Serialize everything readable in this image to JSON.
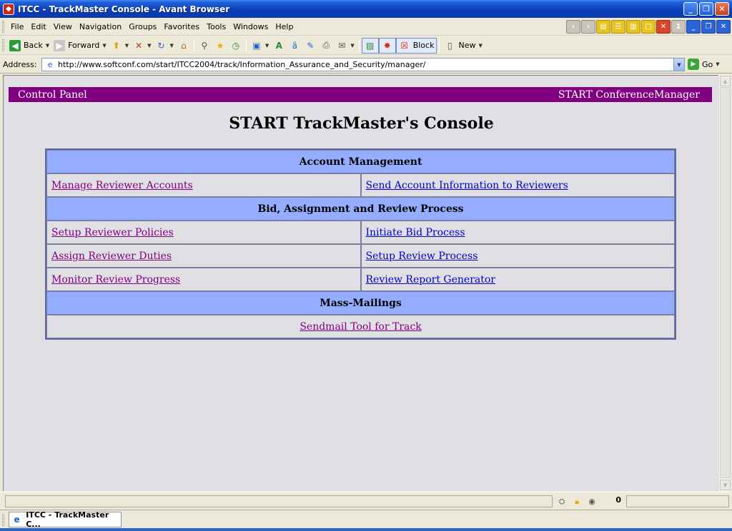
{
  "window": {
    "title": "ITCC - TrackMaster Console - Avant Browser",
    "minimize": "_",
    "maximize": "❐",
    "close": "✕"
  },
  "menu": [
    "File",
    "Edit",
    "View",
    "Navigation",
    "Groups",
    "Favorites",
    "Tools",
    "Windows",
    "Help"
  ],
  "mdi_counter": "1",
  "toolbar": {
    "back_label": "Back",
    "forward_label": "Forward",
    "block_label": "Block",
    "new_label": "New"
  },
  "address": {
    "label": "Address:",
    "url": "http://www.softconf.com/start/ITCC2004/track/Information_Assurance_and_Security/manager/",
    "go_label": "Go"
  },
  "page": {
    "header_left": "Control Panel",
    "header_right": "START ConferenceManager",
    "title": "START TrackMaster's Console",
    "header_color": "#800080",
    "section_color": "#94adff",
    "sections": {
      "account": "Account Management",
      "bid": "Bid, Assignment and Review Process",
      "mail": "Mass-Mailings"
    },
    "links": {
      "manage_reviewer_accounts": "Manage Reviewer Accounts",
      "send_account_info": "Send Account Information to Reviewers",
      "setup_reviewer_policies": "Setup Reviewer Policies",
      "initiate_bid_process": "Initiate Bid Process",
      "assign_reviewer_duties": "Assign Reviewer Duties",
      "setup_review_process": "Setup Review Process",
      "monitor_review_progress": "Monitor Review Progress",
      "review_report_generator": "Review Report Generator",
      "sendmail_tool": "Sendmail Tool for Track"
    }
  },
  "status": {
    "count": "0"
  },
  "tabs": [
    {
      "label": "ITCC - TrackMaster C..."
    }
  ]
}
